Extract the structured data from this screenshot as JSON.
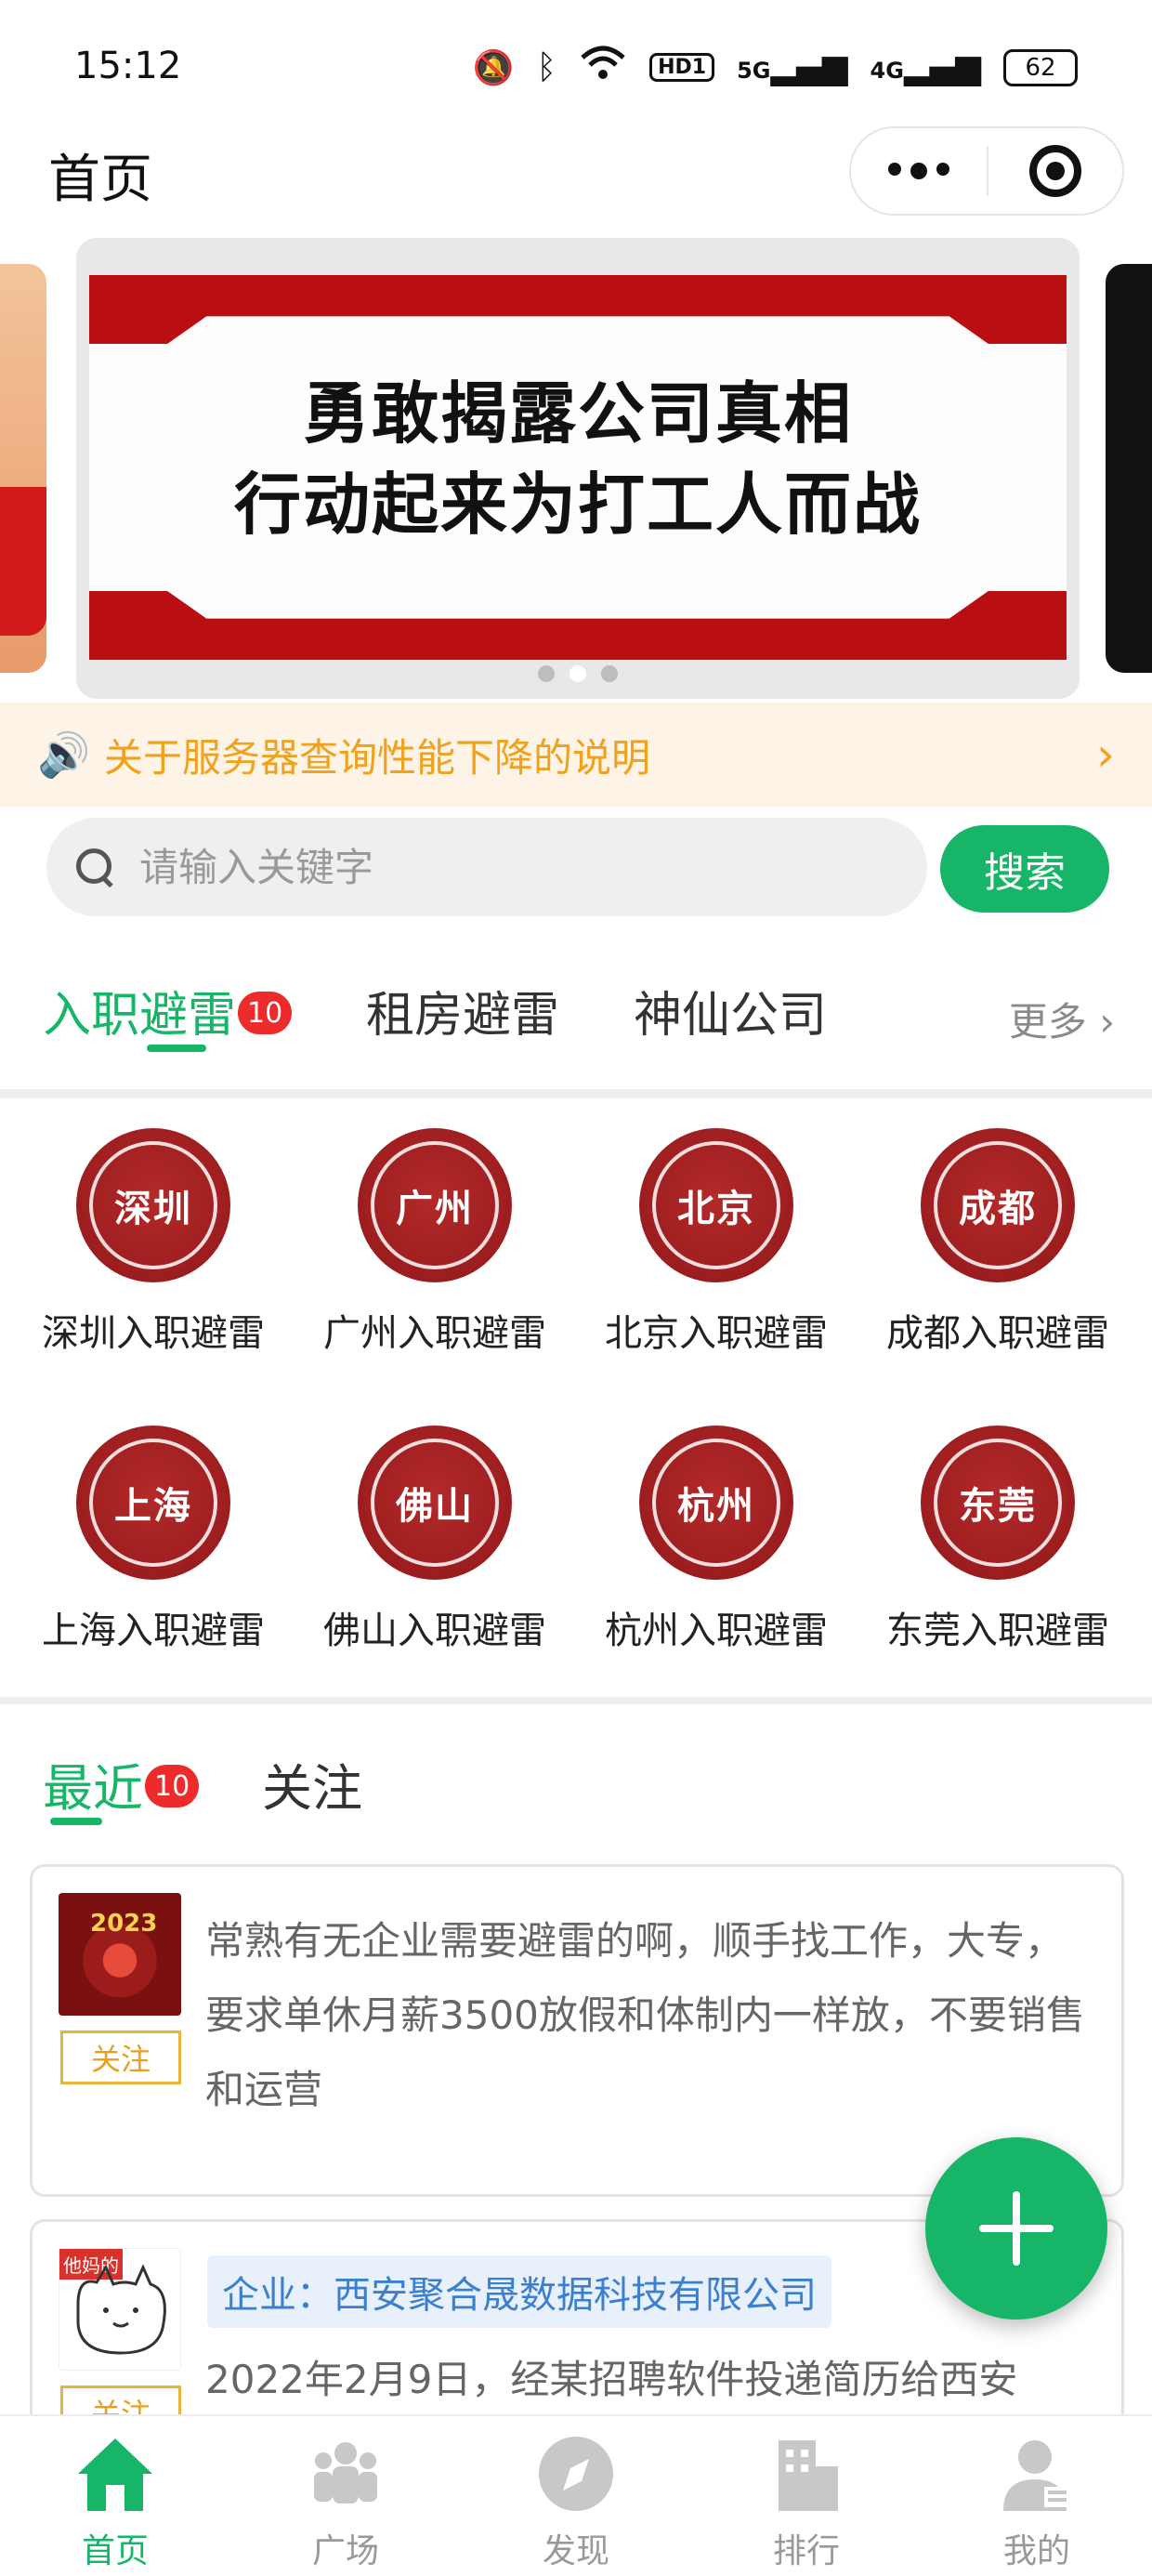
{
  "status": {
    "time": "15:12",
    "battery": "62",
    "net1": "5G",
    "net2": "4G",
    "hd": "HD1"
  },
  "header": {
    "title": "首页"
  },
  "banner": {
    "line1": "勇敢揭露公司真相",
    "line2": "行动起来为打工人而战"
  },
  "notice": {
    "text": "关于服务器查询性能下降的说明"
  },
  "search": {
    "placeholder": "请输入关键字",
    "button": "搜索"
  },
  "category_tabs": [
    {
      "label": "入职避雷",
      "badge": "10"
    },
    {
      "label": "租房避雷"
    },
    {
      "label": "神仙公司"
    }
  ],
  "more_label": "更多",
  "cities": [
    {
      "seal": "深圳",
      "label": "深圳入职避雷"
    },
    {
      "seal": "广州",
      "label": "广州入职避雷"
    },
    {
      "seal": "北京",
      "label": "北京入职避雷"
    },
    {
      "seal": "成都",
      "label": "成都入职避雷"
    },
    {
      "seal": "上海",
      "label": "上海入职避雷"
    },
    {
      "seal": "佛山",
      "label": "佛山入职避雷"
    },
    {
      "seal": "杭州",
      "label": "杭州入职避雷"
    },
    {
      "seal": "东莞",
      "label": "东莞入职避雷"
    }
  ],
  "feed_tabs": [
    {
      "label": "最近",
      "badge": "10"
    },
    {
      "label": "关注"
    }
  ],
  "posts": [
    {
      "follow": "关注",
      "text": "常熟有无企业需要避雷的啊，顺手找工作，大专，要求单休月薪3500放假和体制内一样放，不要销售和运营",
      "avatar_text": "2023"
    },
    {
      "follow": "关注",
      "company": "企业：西安聚合晟数据科技有限公司",
      "text": "2022年2月9日，经某招聘软件投递简历给西安",
      "avatar_text": "他妈的"
    }
  ],
  "nav": [
    {
      "label": "首页",
      "icon": "home-icon"
    },
    {
      "label": "广场",
      "icon": "people-icon"
    },
    {
      "label": "发现",
      "icon": "compass-icon"
    },
    {
      "label": "排行",
      "icon": "building-icon"
    },
    {
      "label": "我的",
      "icon": "user-icon"
    }
  ],
  "colors": {
    "accent": "#16b567",
    "notice": "#f0a21c",
    "badge": "#ee2b2b",
    "seal": "#a01f20"
  }
}
